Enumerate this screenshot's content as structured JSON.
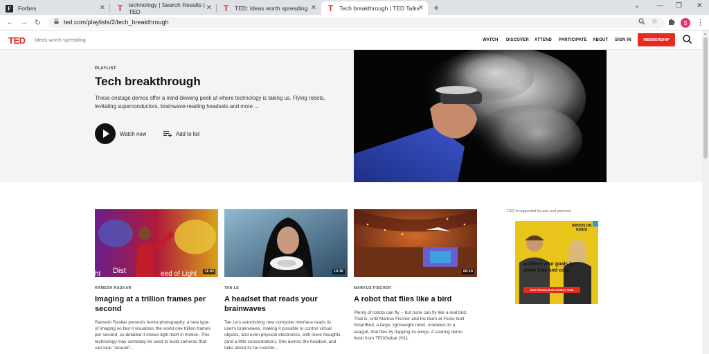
{
  "browser": {
    "tabs": [
      {
        "label": "Forbes",
        "favicon": "F"
      },
      {
        "label": "technology | Search Results | TED",
        "favicon": "T"
      },
      {
        "label": "TED: Ideas worth spreading",
        "favicon": "T"
      },
      {
        "label": "Tech breakthrough | TED Talks",
        "favicon": "T"
      }
    ],
    "close_glyph": "✕",
    "newtab_glyph": "+",
    "window_controls": [
      "⌄",
      "—",
      "❐",
      "✕"
    ],
    "back_glyph": "←",
    "forward_glyph": "→",
    "reload_glyph": "↻",
    "url": "ted.com/playlists/2/tech_breakthrough",
    "profile_initial": "S"
  },
  "header": {
    "logo": "TED",
    "tagline": "Ideas worth spreading",
    "nav": [
      "WATCH",
      "DISCOVER",
      "ATTEND",
      "PARTICIPATE",
      "ABOUT",
      "SIGN IN"
    ],
    "membership": "MEMBERSHIP"
  },
  "hero": {
    "label": "PLAYLIST",
    "title": "Tech breakthrough",
    "description": "These onstage demos offer a mind-blowing peek at where technology is taking us. Flying robots, levitating superconductors, brainwave-reading headsets and more ...",
    "watch_now": "Watch now",
    "add_to_list": "Add to list"
  },
  "talks": [
    {
      "speaker": "RAMESH RASKAR",
      "title": "Imaging at a trillion frames per second",
      "duration": "11:02",
      "description": "Ramesh Raskar presents femto-photography, a new type of imaging so fast it visualizes the world one trillion frames per second, so detailed it shows light itself in motion. This technology may someday be used to build cameras that can look \"around\"...",
      "thumb_caption_left": "Dist",
      "thumb_caption_right": "eed of Light",
      "thumb_caption_edge": "ht"
    },
    {
      "speaker": "TAN LE",
      "title": "A headset that reads your brainwaves",
      "duration": "10:36",
      "description": "Tan Le's astonishing new computer interface reads its user's brainwaves, making it possible to control virtual objects, and even physical electronics, with mere thoughts (and a little concentration). She demos the headset, and talks about its far-reachin..."
    },
    {
      "speaker": "MARKUS FISCHER",
      "title": "A robot that flies like a bird",
      "duration": "06:19",
      "description": "Plenty of robots can fly -- but none can fly like a real bird. That is, until Markus Fischer and his team at Festo built SmartBird, a large, lightweight robot, modeled on a seagull, that flies by flapping its wings. A soaring demo fresh from TEDGlobal 2011."
    }
  ],
  "ad": {
    "label": "TED is supported by ads and partners",
    "badge": "DROIDS ON ROIDS",
    "headline": "Achieve your goals in given time and cost",
    "button": "HIRE PROVEN DEVELOPMENT TEAM"
  },
  "colors": {
    "ted_red": "#e62b1e",
    "hero_bg": "#f4f4f4",
    "ad_yellow": "#e9c41a"
  }
}
